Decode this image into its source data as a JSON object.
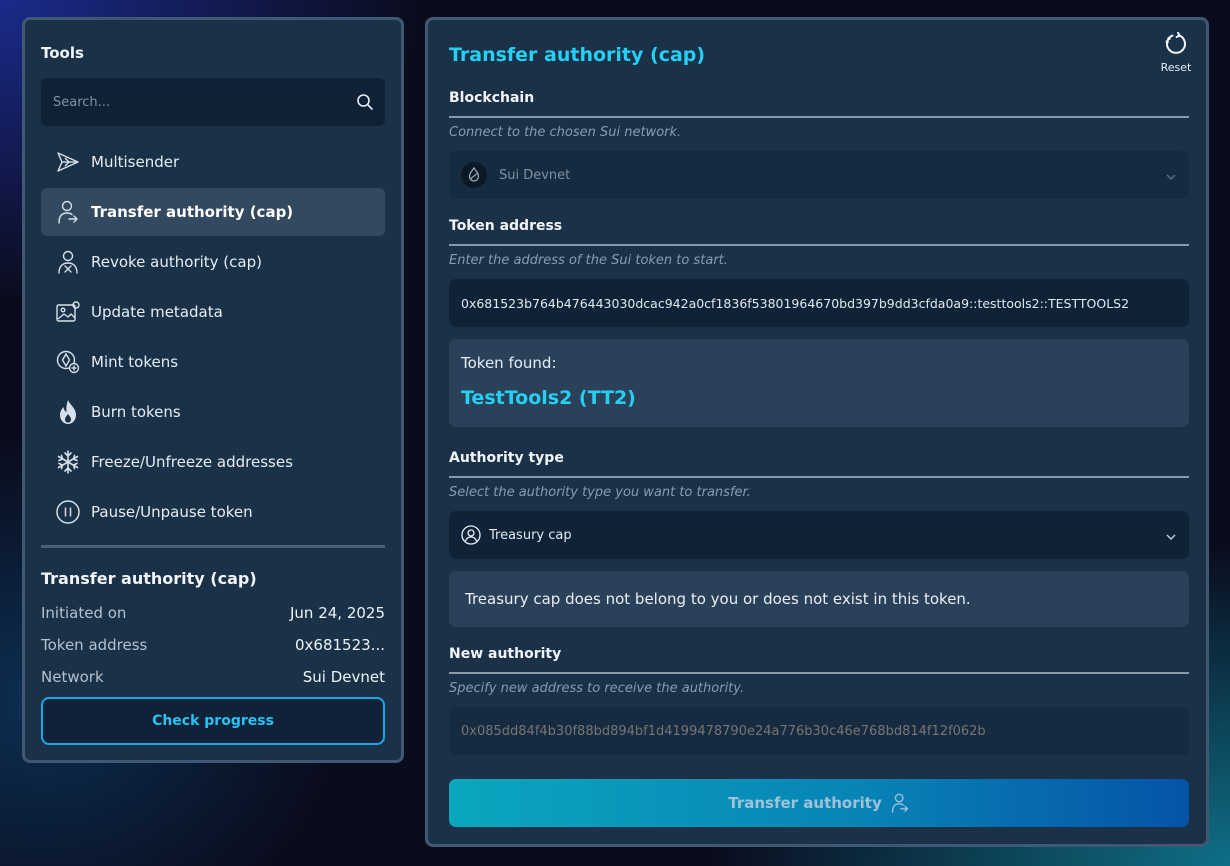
{
  "sidebar": {
    "title": "Tools",
    "search_placeholder": "Search...",
    "items": [
      {
        "label": "Multisender",
        "icon": "paper-plane-icon"
      },
      {
        "label": "Transfer authority (cap)",
        "icon": "user-transfer-icon",
        "active": true
      },
      {
        "label": "Revoke authority (cap)",
        "icon": "user-revoke-icon"
      },
      {
        "label": "Update metadata",
        "icon": "image-edit-icon"
      },
      {
        "label": "Mint tokens",
        "icon": "coin-plus-icon"
      },
      {
        "label": "Burn tokens",
        "icon": "flame-icon"
      },
      {
        "label": "Freeze/Unfreeze addresses",
        "icon": "snowflake-icon"
      },
      {
        "label": "Pause/Unpause token",
        "icon": "pause-circle-icon"
      }
    ],
    "summary": {
      "title": "Transfer authority (cap)",
      "rows": [
        {
          "key": "Initiated on",
          "value": "Jun 24, 2025"
        },
        {
          "key": "Token address",
          "value": "0x681523..."
        },
        {
          "key": "Network",
          "value": "Sui Devnet"
        }
      ],
      "button": "Check progress"
    }
  },
  "main": {
    "title": "Transfer authority (cap)",
    "reset_label": "Reset",
    "blockchain": {
      "label": "Blockchain",
      "hint": "Connect to the chosen Sui network.",
      "value": "Sui Devnet"
    },
    "token_address": {
      "label": "Token address",
      "hint": "Enter the address of the Sui token to start.",
      "value": "0x681523b764b476443030dcac942a0cf1836f53801964670bd397b9dd3cfda0a9::testtools2::TESTTOOLS2"
    },
    "token_found": {
      "label": "Token found:",
      "name": "TestTools2 (TT2)"
    },
    "authority_type": {
      "label": "Authority type",
      "hint": "Select the authority type you want to transfer.",
      "value": "Treasury cap"
    },
    "notice": "Treasury cap does not belong to you or does not exist in this token.",
    "new_authority": {
      "label": "New authority",
      "hint": "Specify new address to receive the authority.",
      "placeholder": "0x085dd84f4b30f88bd894bf1d4199478790e24a776b30c46e768bd814f12f062b"
    },
    "submit_label": "Transfer authority"
  },
  "colors": {
    "accent_cyan": "#24d0f4",
    "panel_bg": "#1a3148",
    "panel_border": "#3f5874"
  }
}
